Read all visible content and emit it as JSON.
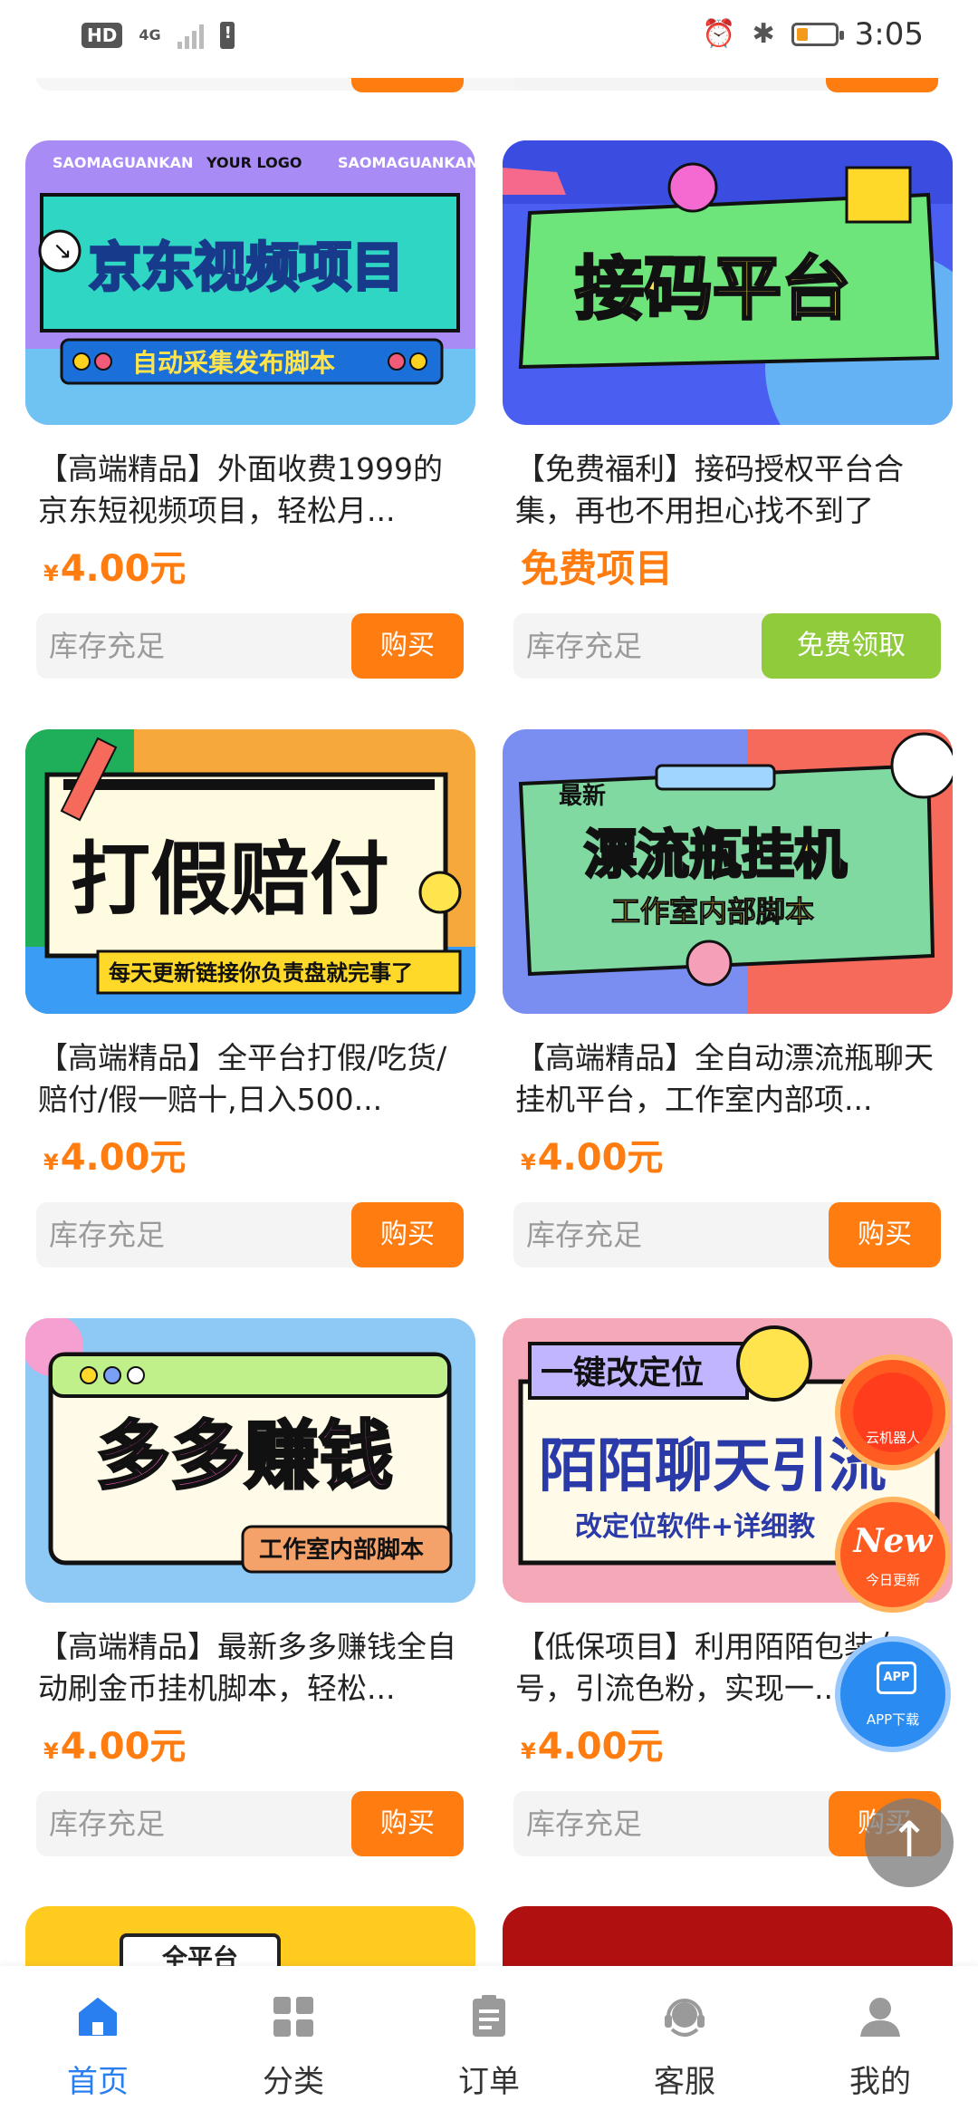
{
  "status_bar": {
    "hd_label": "HD",
    "network_label": "4G",
    "time": "3:05",
    "icons": [
      "alarm-icon",
      "bluetooth-icon",
      "battery-icon"
    ]
  },
  "products": [
    {
      "id": "jd-video",
      "title": "【高端精品】外面收费1999的京东短视频项目，轻松月...",
      "price_symbol": "¥",
      "price": "4.00元",
      "stock": "库存充足",
      "button": "购买",
      "banner": {
        "tag": "SAOMAGUANKAN",
        "logo": "YOUR LOGO",
        "headline": "京东视频项目",
        "sub": "自动采集发布脚本"
      }
    },
    {
      "id": "code-platform",
      "title": "【免费福利】接码授权平台合集，再也不用担心找不到了",
      "price": "免费项目",
      "stock": "库存充足",
      "button": "免费领取",
      "banner": {
        "headline": "接码平台"
      }
    },
    {
      "id": "anti-fake",
      "title": "【高端精品】全平台打假/吃货/赔付/假一赔十,日入500...",
      "price_symbol": "¥",
      "price": "4.00元",
      "stock": "库存充足",
      "button": "购买",
      "banner": {
        "headline": "打假赔付",
        "sub": "每天更新链接你负责盘就完事了"
      }
    },
    {
      "id": "drift-bottle",
      "title": "【高端精品】全自动漂流瓶聊天挂机平台，工作室内部项...",
      "price_symbol": "¥",
      "price": "4.00元",
      "stock": "库存充足",
      "button": "购买",
      "banner": {
        "tag": "最新",
        "headline": "漂流瓶挂机",
        "sub": "工作室内部脚本"
      }
    },
    {
      "id": "duoduo",
      "title": "【高端精品】最新多多赚钱全自动刷金币挂机脚本，轻松...",
      "price_symbol": "¥",
      "price": "4.00元",
      "stock": "库存充足",
      "button": "购买",
      "banner": {
        "headline": "多多赚钱",
        "sub": "工作室内部脚本"
      }
    },
    {
      "id": "momo",
      "title": "【低保项目】利用陌陌包装女号，引流色粉，实现一...",
      "price_symbol": "¥",
      "price": "4.00元",
      "stock": "库存充足",
      "button": "购买",
      "banner": {
        "tag": "一键改定位",
        "headline": "陌陌聊天引流",
        "sub": "改定位软件+详细教"
      }
    }
  ],
  "bottom_partial": {
    "left_tag": "全平台"
  },
  "floating": {
    "robot_label": "云机器人",
    "new_label": "New",
    "new_sub": "今日更新",
    "app_icon_text": "APP",
    "app_label": "APP下载",
    "back_top": "↑"
  },
  "tabs": [
    {
      "label": "首页",
      "active": true
    },
    {
      "label": "分类",
      "active": false
    },
    {
      "label": "订单",
      "active": false
    },
    {
      "label": "客服",
      "active": false
    },
    {
      "label": "我的",
      "active": false
    }
  ],
  "colors": {
    "accent": "#ff7d10",
    "free_button": "#8fcb3a",
    "tab_active": "#2a7ff0",
    "app_float": "#2a8cf0",
    "robot_float": "#ff5a1f"
  }
}
